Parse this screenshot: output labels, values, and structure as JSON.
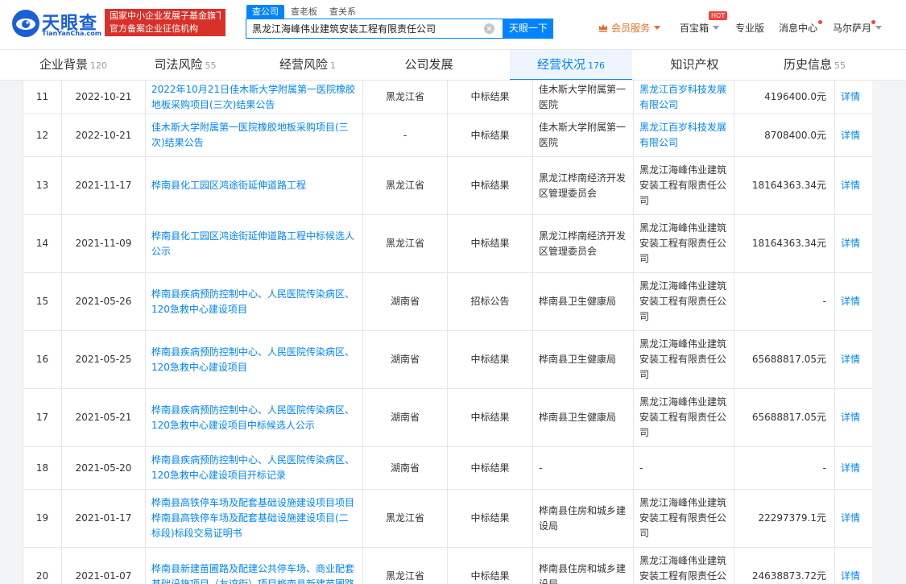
{
  "header": {
    "logo_text": "天眼查",
    "logo_sub": "TianYanCha.com",
    "slogan_line1": "国家中小企业发展子基金旗下",
    "slogan_line2": "官方备案企业征信机构",
    "search_tabs": [
      "查公司",
      "查老板",
      "查关系"
    ],
    "search_value": "黑龙江海峰伟业建筑安装工程有限责任公司",
    "search_button": "天眼一下",
    "vip_label": "会员服务",
    "treasure_label": "百宝箱",
    "hot_badge": "HOT",
    "pro_label": "专业版",
    "msg_label": "消息中心",
    "user_label": "马尔萨月"
  },
  "tabs": [
    {
      "label": "企业背景",
      "count": "120"
    },
    {
      "label": "司法风险",
      "count": "55"
    },
    {
      "label": "经营风险",
      "count": "1"
    },
    {
      "label": "公司发展",
      "count": ""
    },
    {
      "label": "经营状况",
      "count": "176"
    },
    {
      "label": "知识产权",
      "count": ""
    },
    {
      "label": "历史信息",
      "count": "55"
    }
  ],
  "table": {
    "rows": [
      {
        "idx": "11",
        "date": "2022-10-21",
        "title": "2022年10月21日佳木斯大学附属第一医院橡胶地板采购项目(三次)结果公告",
        "region": "黑龙江省",
        "type": "中标结果",
        "buyer": "佳木斯大学附属第一医院",
        "supplier": "黑龙江百岁科技发展有限公司",
        "amount": "4196400.0元",
        "action": "详情"
      },
      {
        "idx": "12",
        "date": "2022-10-21",
        "title": "佳木斯大学附属第一医院橡胶地板采购项目(三次)结果公告",
        "region": "-",
        "type": "中标结果",
        "buyer": "佳木斯大学附属第一医院",
        "supplier": "黑龙江百岁科技发展有限公司",
        "amount": "8708400.0元",
        "action": "详情"
      },
      {
        "idx": "13",
        "date": "2021-11-17",
        "title": "桦南县化工园区鸿途街延伸道路工程",
        "region": "黑龙江省",
        "type": "中标结果",
        "buyer": "黑龙江桦南经济开发区管理委员会",
        "supplier": "黑龙江海峰伟业建筑安装工程有限责任公司",
        "amount": "18164363.34元",
        "action": "详情"
      },
      {
        "idx": "14",
        "date": "2021-11-09",
        "title": "桦南县化工园区鸿途街延伸道路工程中标候选人公示",
        "region": "黑龙江省",
        "type": "中标结果",
        "buyer": "黑龙江桦南经济开发区管理委员会",
        "supplier": "黑龙江海峰伟业建筑安装工程有限责任公司",
        "amount": "18164363.34元",
        "action": "详情"
      },
      {
        "idx": "15",
        "date": "2021-05-26",
        "title": "桦南县疾病预防控制中心、人民医院传染病区、120急救中心建设项目",
        "region": "湖南省",
        "type": "招标公告",
        "buyer": "桦南县卫生健康局",
        "supplier": "黑龙江海峰伟业建筑安装工程有限责任公司",
        "amount": "-",
        "action": "详情"
      },
      {
        "idx": "16",
        "date": "2021-05-25",
        "title": "桦南县疾病预防控制中心、人民医院传染病区、120急救中心建设项目",
        "region": "湖南省",
        "type": "中标结果",
        "buyer": "桦南县卫生健康局",
        "supplier": "黑龙江海峰伟业建筑安装工程有限责任公司",
        "amount": "65688817.05元",
        "action": "详情"
      },
      {
        "idx": "17",
        "date": "2021-05-21",
        "title": "桦南县疾病预防控制中心、人民医院传染病区、120急救中心建设项目中标候选人公示",
        "region": "湖南省",
        "type": "中标结果",
        "buyer": "桦南县卫生健康局",
        "supplier": "黑龙江海峰伟业建筑安装工程有限责任公司",
        "amount": "65688817.05元",
        "action": "详情"
      },
      {
        "idx": "18",
        "date": "2021-05-20",
        "title": "桦南县疾病预防控制中心、人民医院传染病区、120急救中心建设项目开标记录",
        "region": "湖南省",
        "type": "中标结果",
        "buyer": "-",
        "supplier": "-",
        "amount": "-",
        "action": "详情"
      },
      {
        "idx": "19",
        "date": "2021-01-17",
        "title": "桦南县高铁停车场及配套基础设施建设项目项目桦南县高铁停车场及配套基础设施建设项目(二标段)标段交易证明书",
        "region": "黑龙江省",
        "type": "中标结果",
        "buyer": "桦南县住房和城乡建设局",
        "supplier": "黑龙江海峰伟业建筑安装工程有限责任公司",
        "amount": "22297379.1元",
        "action": "详情"
      },
      {
        "idx": "20",
        "date": "2021-01-07",
        "title": "桦南县新建苗圃路及配建公共停车场、商业配套基础设施项目（友谊街）项目桦南县新建苗圃路",
        "region": "黑龙江省",
        "type": "中标结果",
        "buyer": "桦南县住房和城乡建设局",
        "supplier": "黑龙江海峰伟业建筑安装工程有限责任公司",
        "amount": "24638873.72元",
        "action": "详情"
      }
    ]
  }
}
